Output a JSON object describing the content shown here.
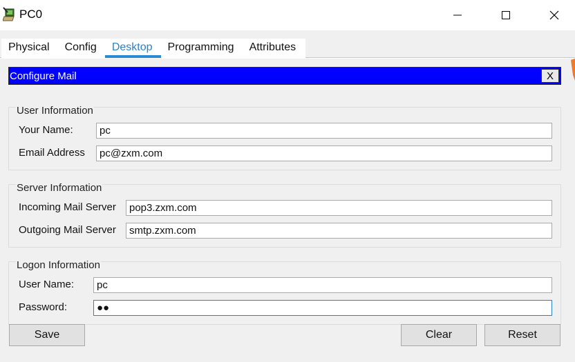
{
  "window": {
    "title": "PC0",
    "controls": {
      "minimize": "minimize",
      "maximize": "maximize",
      "close": "close"
    }
  },
  "tabs": [
    {
      "label": "Physical"
    },
    {
      "label": "Config"
    },
    {
      "label": "Desktop",
      "active": true
    },
    {
      "label": "Programming"
    },
    {
      "label": "Attributes"
    }
  ],
  "panel": {
    "title": "Configure Mail",
    "close_label": "X",
    "header_color": "#0000ff"
  },
  "user_info": {
    "legend": "User Information",
    "name_label": "Your Name:",
    "name_value": "pc",
    "email_label": "Email Address",
    "email_value": "pc@zxm.com"
  },
  "server_info": {
    "legend": "Server Information",
    "incoming_label": "Incoming Mail Server",
    "incoming_value": "pop3.zxm.com",
    "outgoing_label": "Outgoing Mail Server",
    "outgoing_value": "smtp.zxm.com"
  },
  "logon_info": {
    "legend": "Logon Information",
    "username_label": "User Name:",
    "username_value": "pc",
    "password_label": "Password:",
    "password_value": "●●"
  },
  "buttons": {
    "save": "Save",
    "clear": "Clear",
    "reset": "Reset"
  },
  "colors": {
    "accent_tab": "#2a8ad4",
    "orange_mark": "#f07a2a"
  }
}
